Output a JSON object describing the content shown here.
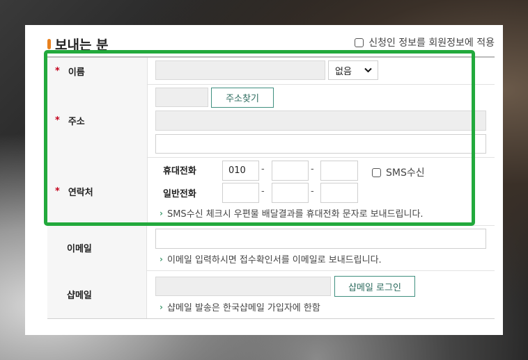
{
  "section": {
    "title": "보내는 분"
  },
  "apply_checkbox": {
    "label": "신청인 정보를 회원정보에 적용"
  },
  "rows": {
    "name": {
      "required": "*",
      "label": "이름",
      "suffix_select": "없음"
    },
    "address": {
      "required": "*",
      "label": "주소",
      "search_button": "주소찾기"
    },
    "contact": {
      "required": "*",
      "label": "연락처",
      "mobile_label": "휴대전화",
      "mobile_prefix": "010",
      "landline_label": "일반전화",
      "dash": "-",
      "sms_checkbox": "SMS수신",
      "note": "SMS수신 체크시 우편물 배달결과를 휴대전화 문자로 보내드립니다."
    },
    "email": {
      "label": "이메일",
      "note": "이메일 입력하시면 접수확인서를 이메일로 보내드립니다."
    },
    "shopmail": {
      "label": "샵메일",
      "login_button": "샵메일 로그인",
      "note": "샵메일 발송은 한국샵메일 가입자에 한함"
    }
  },
  "note_arrow": "›",
  "colors": {
    "accent_bar": "#e8811e",
    "required": "#c4001a",
    "button_border": "#3f8f7f",
    "highlight": "#22a93c"
  }
}
